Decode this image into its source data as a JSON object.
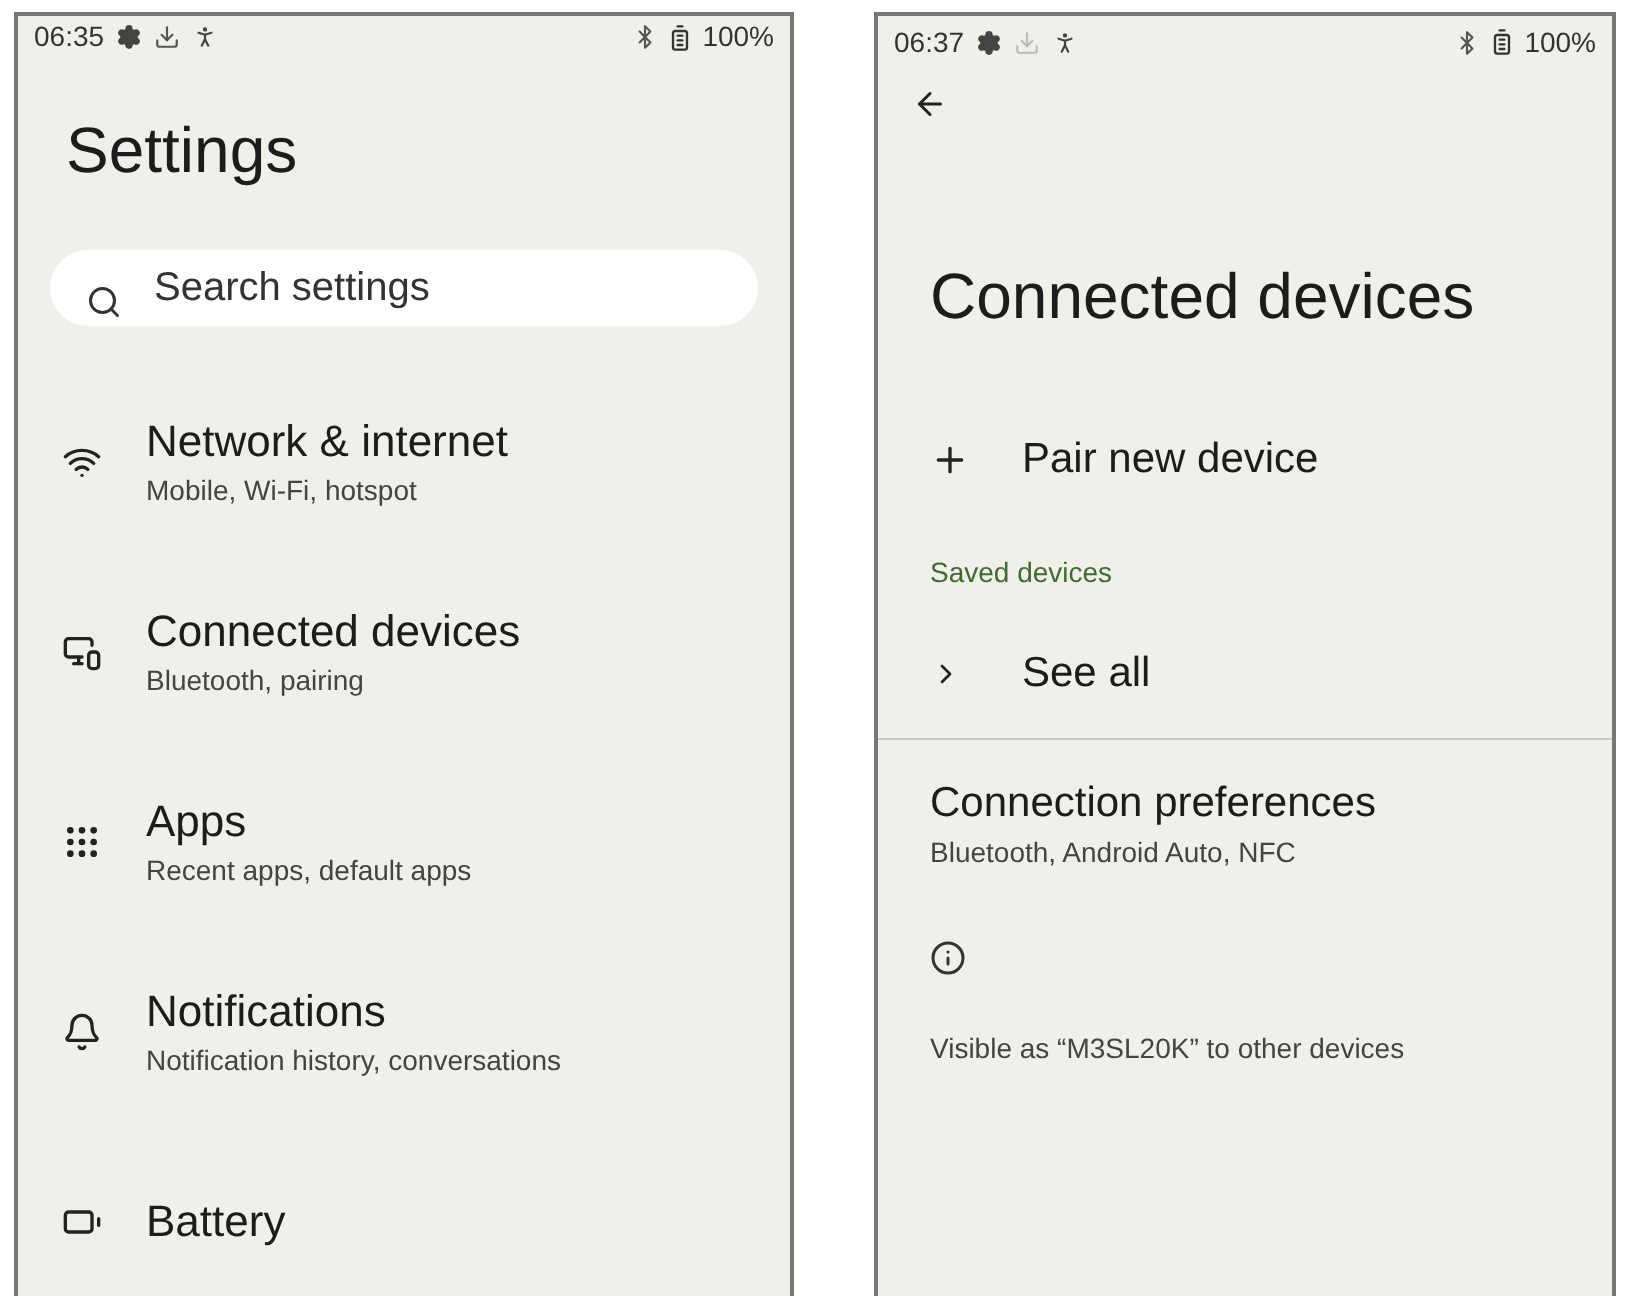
{
  "settings_screen": {
    "status_bar": {
      "time": "06:35",
      "battery": "100%"
    },
    "title": "Settings",
    "search": {
      "placeholder": "Search settings"
    },
    "items": [
      {
        "kind": "wifi",
        "title": "Network & internet",
        "subtitle": "Mobile, Wi-Fi, hotspot"
      },
      {
        "kind": "devices",
        "title": "Connected devices",
        "subtitle": "Bluetooth, pairing"
      },
      {
        "kind": "apps",
        "title": "Apps",
        "subtitle": "Recent apps, default apps"
      },
      {
        "kind": "bell",
        "title": "Notifications",
        "subtitle": "Notification history, conversations"
      },
      {
        "kind": "battery",
        "title": "Battery"
      }
    ]
  },
  "connected_devices_screen": {
    "status_bar": {
      "time": "06:37",
      "battery": "100%"
    },
    "title": "Connected devices",
    "pair_new_device": "Pair new device",
    "section_header": "Saved devices",
    "see_all": "See all",
    "connection_preferences": {
      "title": "Connection preferences",
      "subtitle": "Bluetooth, Android Auto, NFC"
    },
    "visible_as": "Visible as “M3SL20K” to other devices"
  }
}
